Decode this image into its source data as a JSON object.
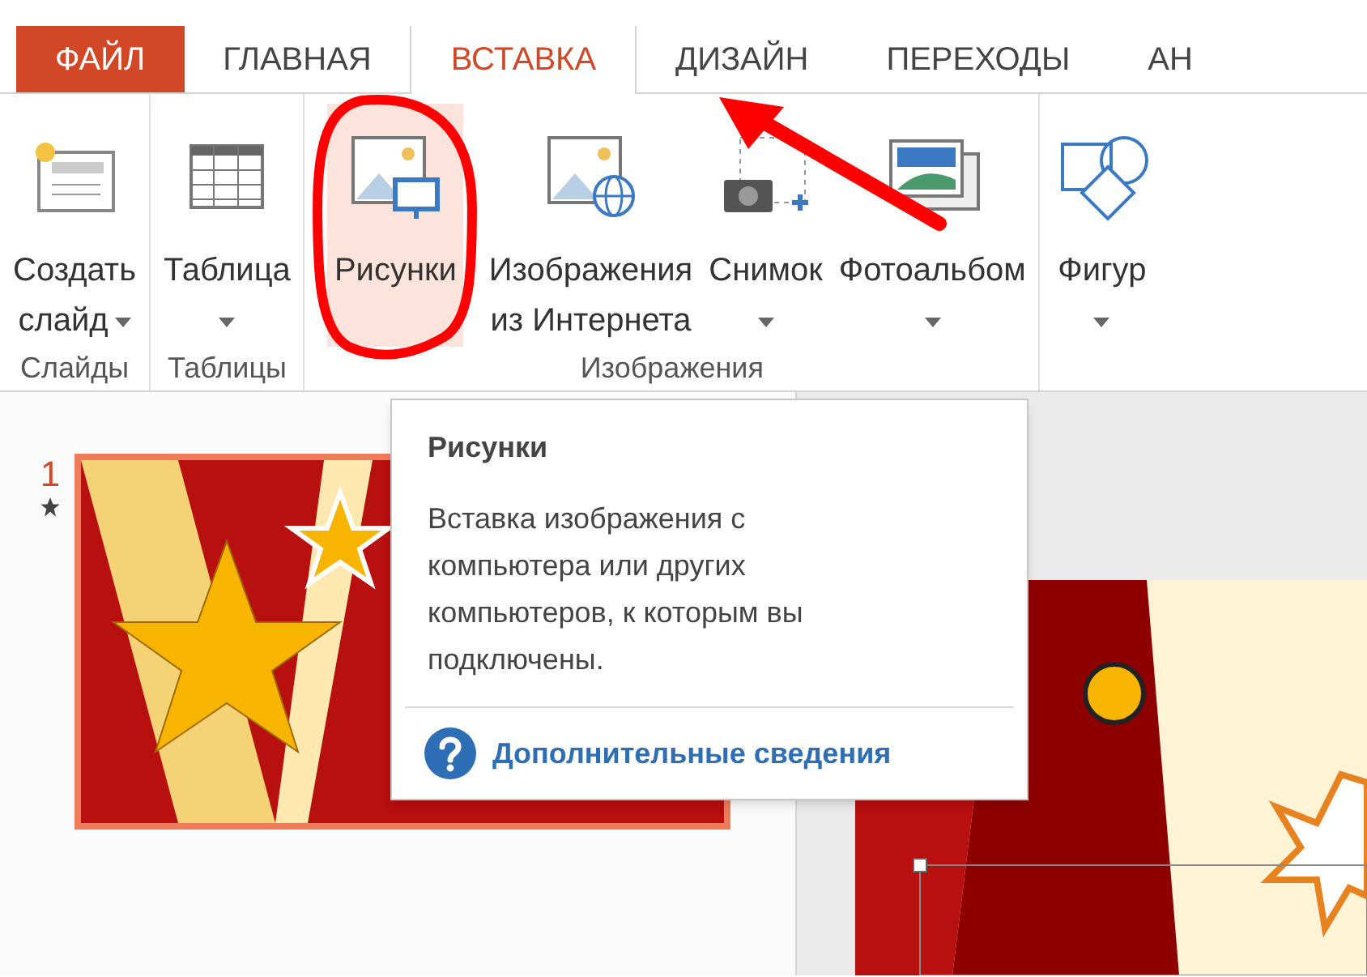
{
  "tabs": [
    {
      "label": "ФАЙЛ",
      "kind": "file",
      "selected": false
    },
    {
      "label": "ГЛАВНАЯ",
      "kind": "tab",
      "selected": false
    },
    {
      "label": "ВСТАВКА",
      "kind": "tab",
      "selected": true
    },
    {
      "label": "ДИЗАЙН",
      "kind": "tab",
      "selected": false
    },
    {
      "label": "ПЕРЕХОДЫ",
      "kind": "tab",
      "selected": false
    },
    {
      "label": "АН",
      "kind": "tab",
      "selected": false
    }
  ],
  "ribbon_groups": [
    {
      "label": "Слайды",
      "buttons": [
        {
          "lines": [
            "Создать",
            "слайд"
          ],
          "dropdown": true,
          "hovered": false,
          "circled": false
        }
      ]
    },
    {
      "label": "Таблицы",
      "buttons": [
        {
          "lines": [
            "Таблица"
          ],
          "dropdown": true,
          "hovered": false,
          "circled": false
        }
      ]
    },
    {
      "label": "Изображения",
      "buttons": [
        {
          "lines": [
            "Рисунки"
          ],
          "dropdown": false,
          "hovered": true,
          "circled": true
        },
        {
          "lines": [
            "Изображения",
            "из Интернета"
          ],
          "dropdown": false,
          "hovered": false,
          "circled": false
        },
        {
          "lines": [
            "Снимок"
          ],
          "dropdown": true,
          "hovered": false,
          "circled": false
        },
        {
          "lines": [
            "Фотоальбом"
          ],
          "dropdown": true,
          "hovered": false,
          "circled": false
        }
      ]
    },
    {
      "buttons": [
        {
          "lines": [
            "Фигур"
          ],
          "dropdown": true,
          "hovered": false,
          "circled": false
        }
      ]
    }
  ],
  "slides_panel": {
    "slides": [
      {
        "number": "1",
        "selected": true,
        "has_animation": true
      }
    ]
  },
  "tooltip": {
    "title": "Рисунки",
    "description": "Вставка изображения с компьютера или других компьютеров, к которым вы подключены.",
    "link": "Дополнительные сведения"
  }
}
